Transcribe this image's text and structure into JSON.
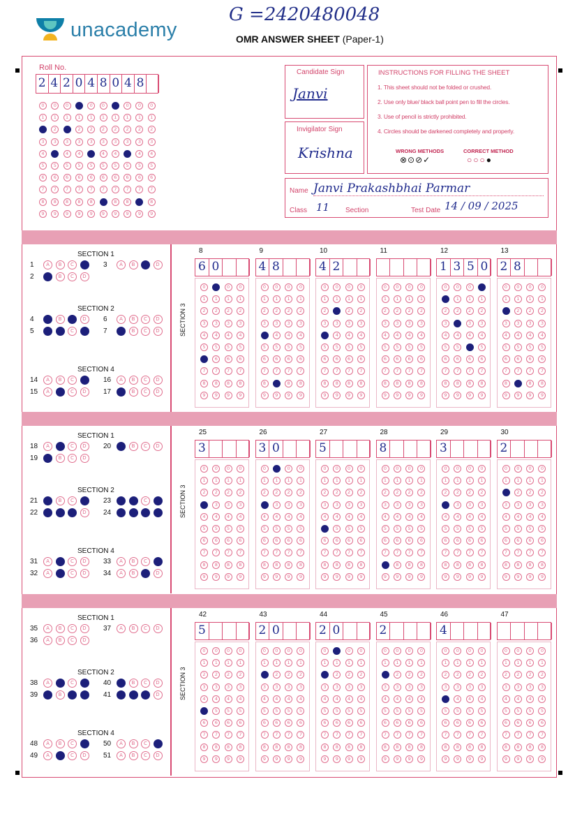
{
  "header": {
    "brand": "unacademy",
    "handwritten_top": "G =2420480048",
    "title_bold": "OMR ANSWER SHEET",
    "title_paper": "(Paper-1)"
  },
  "roll": {
    "label": "Roll No.",
    "digits": [
      "2",
      "4",
      "2",
      "0",
      "4",
      "8",
      "0",
      "4",
      "8",
      ""
    ],
    "filled": [
      2,
      4,
      2,
      0,
      4,
      8,
      0,
      4,
      8
    ]
  },
  "candidate_sign": {
    "label": "Candidate Sign",
    "signature": "Janvi"
  },
  "invigilator_sign": {
    "label": "Invigilator Sign",
    "signature": "Krishna"
  },
  "instructions": {
    "title": "INSTRUCTIONS FOR FILLING THE SHEET",
    "items": [
      "1. This sheet should not be folded or crushed.",
      "2. Use only blue/ black ball point pen to fill the circles.",
      "3. Use of pencil is strictly prohibited.",
      "4. Circles should be darkened completely and properly."
    ],
    "wrong_label": "WRONG METHODS",
    "correct_label": "CORRECT METHOD"
  },
  "candidate": {
    "name_label": "Name",
    "name_value": "Janvi Prakashbhai Parmar",
    "class_label": "Class",
    "class_value": "11",
    "section_label": "Section",
    "section_value": "",
    "date_label": "Test Date",
    "date_value": "14 / 09 / 2025"
  },
  "labels": {
    "section1": "SECTION 1",
    "section2": "SECTION 2",
    "section3": "SECTION 3",
    "section4": "SECTION 4",
    "options": [
      "A",
      "B",
      "C",
      "D"
    ]
  },
  "blocks": [
    {
      "mcq": {
        "s1": [
          {
            "q": "1",
            "filled": [
              3
            ]
          },
          {
            "q": "3",
            "filled": [
              2
            ]
          },
          {
            "q": "2",
            "filled": [
              0
            ]
          }
        ],
        "s2": [
          {
            "q": "4",
            "filled": [
              0,
              2
            ]
          },
          {
            "q": "6",
            "filled": []
          },
          {
            "q": "5",
            "filled": [
              0,
              1,
              3
            ]
          },
          {
            "q": "7",
            "filled": [
              0
            ]
          }
        ],
        "s4": [
          {
            "q": "14",
            "filled": [
              3
            ]
          },
          {
            "q": "16",
            "filled": []
          },
          {
            "q": "15",
            "filled": [
              1
            ]
          },
          {
            "q": "17",
            "filled": [
              0
            ]
          }
        ]
      },
      "numeric": [
        {
          "q": "8",
          "written": [
            "6",
            "0",
            "",
            ""
          ],
          "filled": [
            6,
            0,
            null,
            null
          ]
        },
        {
          "q": "9",
          "written": [
            "4",
            "8",
            "",
            ""
          ],
          "filled": [
            4,
            8,
            null,
            null
          ]
        },
        {
          "q": "10",
          "written": [
            "4",
            "2",
            "",
            ""
          ],
          "filled": [
            4,
            2,
            null,
            null
          ]
        },
        {
          "q": "11",
          "written": [
            "",
            "",
            "",
            ""
          ],
          "filled": [
            null,
            null,
            null,
            null
          ]
        },
        {
          "q": "12",
          "written": [
            "1",
            "3",
            "5",
            "0"
          ],
          "filled": [
            1,
            3,
            5,
            0
          ]
        },
        {
          "q": "13",
          "written": [
            "2",
            "8",
            "",
            ""
          ],
          "filled": [
            2,
            8,
            null,
            null
          ]
        }
      ]
    },
    {
      "mcq": {
        "s1": [
          {
            "q": "18",
            "filled": [
              1
            ]
          },
          {
            "q": "20",
            "filled": [
              0
            ]
          },
          {
            "q": "19",
            "filled": [
              0
            ]
          }
        ],
        "s2": [
          {
            "q": "21",
            "filled": [
              0,
              3
            ]
          },
          {
            "q": "23",
            "filled": [
              0,
              1,
              3
            ]
          },
          {
            "q": "22",
            "filled": [
              0,
              1,
              2
            ]
          },
          {
            "q": "24",
            "filled": [
              0,
              1,
              2,
              3
            ]
          }
        ],
        "s4": [
          {
            "q": "31",
            "filled": [
              1
            ]
          },
          {
            "q": "33",
            "filled": [
              3
            ]
          },
          {
            "q": "32",
            "filled": [
              1
            ]
          },
          {
            "q": "34",
            "filled": [
              2
            ]
          }
        ]
      },
      "numeric": [
        {
          "q": "25",
          "written": [
            "3",
            "",
            "",
            ""
          ],
          "filled": [
            3,
            null,
            null,
            null
          ]
        },
        {
          "q": "26",
          "written": [
            "3",
            "0",
            "",
            ""
          ],
          "filled": [
            3,
            0,
            null,
            null
          ]
        },
        {
          "q": "27",
          "written": [
            "5",
            "",
            "",
            ""
          ],
          "filled": [
            5,
            null,
            null,
            null
          ]
        },
        {
          "q": "28",
          "written": [
            "8",
            "",
            "",
            ""
          ],
          "filled": [
            8,
            null,
            null,
            null
          ]
        },
        {
          "q": "29",
          "written": [
            "3",
            "",
            "",
            ""
          ],
          "filled": [
            3,
            null,
            null,
            null
          ]
        },
        {
          "q": "30",
          "written": [
            "2",
            "",
            "",
            ""
          ],
          "filled": [
            2,
            null,
            null,
            null
          ]
        }
      ]
    },
    {
      "mcq": {
        "s1": [
          {
            "q": "35",
            "filled": []
          },
          {
            "q": "37",
            "filled": []
          },
          {
            "q": "36",
            "filled": []
          }
        ],
        "s2": [
          {
            "q": "38",
            "filled": [
              1,
              3
            ]
          },
          {
            "q": "40",
            "filled": [
              0
            ]
          },
          {
            "q": "39",
            "filled": [
              0,
              2,
              3
            ]
          },
          {
            "q": "41",
            "filled": [
              0,
              1,
              2
            ]
          }
        ],
        "s4": [
          {
            "q": "48",
            "filled": [
              3
            ]
          },
          {
            "q": "50",
            "filled": [
              3
            ]
          },
          {
            "q": "49",
            "filled": [
              1
            ]
          },
          {
            "q": "51",
            "filled": []
          }
        ]
      },
      "numeric": [
        {
          "q": "42",
          "written": [
            "5",
            "",
            "",
            ""
          ],
          "filled": [
            5,
            null,
            null,
            null
          ]
        },
        {
          "q": "43",
          "written": [
            "2",
            "0",
            "",
            ""
          ],
          "filled": [
            2,
            null,
            null,
            null
          ]
        },
        {
          "q": "44",
          "written": [
            "2",
            "0",
            "",
            ""
          ],
          "filled": [
            2,
            0,
            null,
            null
          ]
        },
        {
          "q": "45",
          "written": [
            "2",
            "",
            "",
            ""
          ],
          "filled": [
            2,
            null,
            null,
            null
          ]
        },
        {
          "q": "46",
          "written": [
            "4",
            "",
            "",
            ""
          ],
          "filled": [
            4,
            null,
            null,
            null
          ]
        },
        {
          "q": "47",
          "written": [
            "",
            "",
            "",
            ""
          ],
          "filled": [
            null,
            null,
            null,
            null
          ]
        }
      ]
    }
  ],
  "colors": {
    "pink": "#d84a72",
    "band": "#e8a0b5",
    "ink": "#1c1f7a"
  }
}
